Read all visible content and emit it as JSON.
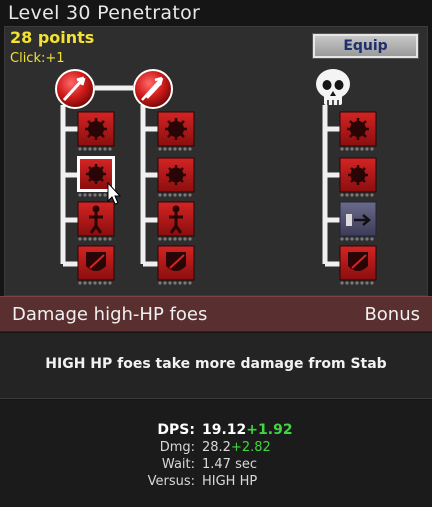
{
  "title": "Level 30 Penetrator",
  "points": "28 points",
  "click": "Click:+1",
  "equip_label": "Equip",
  "tree": {
    "heads": [
      "spear-icon",
      "spear-icon",
      "skull-icon"
    ],
    "skills": [
      [
        "gear-icon",
        "gear-icon",
        "figure-icon",
        "chest-icon"
      ],
      [
        "gear-icon",
        "gear-icon",
        "figure-icon",
        "chest-icon"
      ],
      [
        "gear-icon",
        "gear-icon",
        "arrow-icon",
        "chest-icon"
      ]
    ],
    "selected": {
      "column": 0,
      "row": 1
    }
  },
  "selected_skill": {
    "name": "Damage high-HP foes",
    "tag": "Bonus",
    "description": "HIGH HP foes take more damage from Stab"
  },
  "stats": {
    "dps_label": "DPS:",
    "dps_value": "19.12",
    "dps_bonus": "+1.92",
    "dmg_label": "Dmg:",
    "dmg_value": "28.2",
    "dmg_bonus": "+2.82",
    "wait_label": "Wait:",
    "wait_value": "1.47 sec",
    "versus_label": "Versus:",
    "versus_value": "HIGH HP"
  },
  "colors": {
    "points_yellow": "#f3e233",
    "skill_red": "#b01818",
    "bonus_green": "#3fd63f",
    "bar_brown": "#5a2f2f"
  }
}
